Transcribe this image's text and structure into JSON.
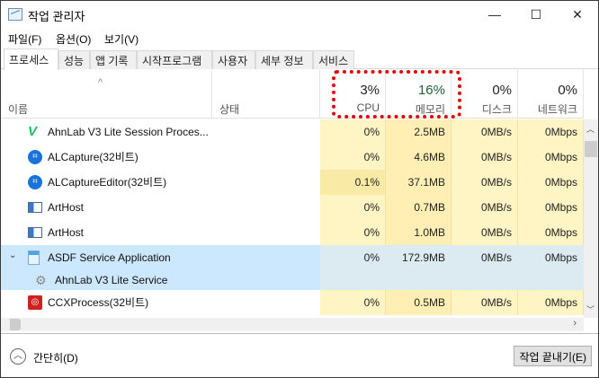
{
  "window": {
    "title": "작업 관리자",
    "minimize": "—",
    "maximize": "☐",
    "close": "✕"
  },
  "menu": [
    "파일(F)",
    "옵션(O)",
    "보기(V)"
  ],
  "tabs": [
    "프로세스",
    "성능",
    "앱 기록",
    "시작프로그램",
    "사용자",
    "세부 정보",
    "서비스"
  ],
  "header": {
    "name": "이름",
    "status": "상태",
    "sort_indicator": "^",
    "cpu": {
      "pct": "3%",
      "label": "CPU"
    },
    "memory": {
      "pct": "16%",
      "label": "메모리"
    },
    "disk": {
      "pct": "0%",
      "label": "디스크"
    },
    "network": {
      "pct": "0%",
      "label": "네트워크"
    }
  },
  "rows": [
    {
      "name": "AhnLab V3 Lite Session Proces...",
      "icon": "v3-icon",
      "cpu": "0%",
      "memory": "2.5MB",
      "disk": "0MB/s",
      "network": "0Mbps"
    },
    {
      "name": "ALCapture(32비트)",
      "icon": "alcapture-icon",
      "cpu": "0%",
      "memory": "4.6MB",
      "disk": "0MB/s",
      "network": "0Mbps"
    },
    {
      "name": "ALCaptureEditor(32비트)",
      "icon": "alcapture-icon",
      "cpu": "0.1%",
      "memory": "37.1MB",
      "disk": "0MB/s",
      "network": "0Mbps"
    },
    {
      "name": "ArtHost",
      "icon": "window-icon",
      "cpu": "0%",
      "memory": "0.7MB",
      "disk": "0MB/s",
      "network": "0Mbps"
    },
    {
      "name": "ArtHost",
      "icon": "window-icon",
      "cpu": "0%",
      "memory": "1.0MB",
      "disk": "0MB/s",
      "network": "0Mbps"
    },
    {
      "name": "ASDF Service Application",
      "icon": "app-icon",
      "cpu": "0%",
      "memory": "172.9MB",
      "disk": "0MB/s",
      "network": "0Mbps"
    },
    {
      "name": "AhnLab V3 Lite Service",
      "icon": "gear-icon"
    },
    {
      "name": "CCXProcess(32비트)",
      "icon": "ccx-icon",
      "cpu": "0%",
      "memory": "0.5MB",
      "disk": "0MB/s",
      "network": "0Mbps"
    }
  ],
  "footer": {
    "collapse": "간단히(D)",
    "end_task": "작업 끝내기(E)"
  },
  "colors": {
    "accent_callout": "#e00000",
    "selected": "#cce8ff",
    "usage_cell": "#fff4c4"
  }
}
